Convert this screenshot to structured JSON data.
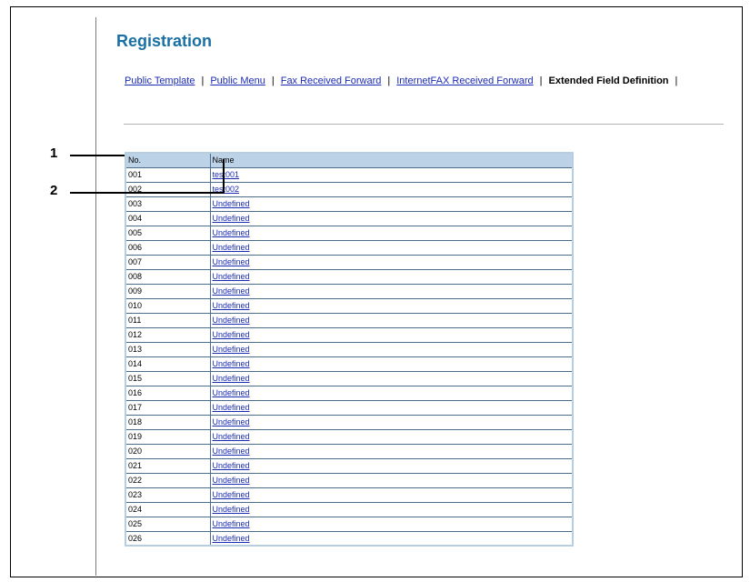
{
  "page": {
    "title": "Registration"
  },
  "tabs": [
    {
      "label": "Public Template",
      "active": false
    },
    {
      "label": "Public Menu",
      "active": false
    },
    {
      "label": "Fax Received Forward",
      "active": false
    },
    {
      "label": "InternetFAX Received Forward",
      "active": false
    },
    {
      "label": "Extended Field Definition",
      "active": true
    }
  ],
  "table": {
    "columns": [
      "No.",
      "Name"
    ],
    "rows": [
      {
        "no": "001",
        "name": "test001"
      },
      {
        "no": "002",
        "name": "test002"
      },
      {
        "no": "003",
        "name": "Undefined"
      },
      {
        "no": "004",
        "name": "Undefined"
      },
      {
        "no": "005",
        "name": "Undefined"
      },
      {
        "no": "006",
        "name": "Undefined"
      },
      {
        "no": "007",
        "name": "Undefined"
      },
      {
        "no": "008",
        "name": "Undefined"
      },
      {
        "no": "009",
        "name": "Undefined"
      },
      {
        "no": "010",
        "name": "Undefined"
      },
      {
        "no": "011",
        "name": "Undefined"
      },
      {
        "no": "012",
        "name": "Undefined"
      },
      {
        "no": "013",
        "name": "Undefined"
      },
      {
        "no": "014",
        "name": "Undefined"
      },
      {
        "no": "015",
        "name": "Undefined"
      },
      {
        "no": "016",
        "name": "Undefined"
      },
      {
        "no": "017",
        "name": "Undefined"
      },
      {
        "no": "018",
        "name": "Undefined"
      },
      {
        "no": "019",
        "name": "Undefined"
      },
      {
        "no": "020",
        "name": "Undefined"
      },
      {
        "no": "021",
        "name": "Undefined"
      },
      {
        "no": "022",
        "name": "Undefined"
      },
      {
        "no": "023",
        "name": "Undefined"
      },
      {
        "no": "024",
        "name": "Undefined"
      },
      {
        "no": "025",
        "name": "Undefined"
      },
      {
        "no": "026",
        "name": "Undefined"
      }
    ]
  },
  "callouts": [
    {
      "label": "1"
    },
    {
      "label": "2"
    }
  ],
  "colors": {
    "title": "#1a6fa3",
    "link": "#1b2bb5",
    "header_bg": "#bcd2e6",
    "grid_line": "#4a6d8c"
  }
}
